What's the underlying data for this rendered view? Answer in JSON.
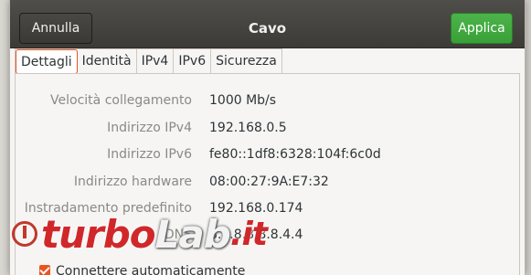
{
  "header": {
    "title": "Cavo",
    "cancel_label": "Annulla",
    "apply_label": "Applica"
  },
  "tabs": [
    {
      "label": "Dettagli",
      "active": true
    },
    {
      "label": "Identità",
      "active": false
    },
    {
      "label": "IPv4",
      "active": false
    },
    {
      "label": "IPv6",
      "active": false
    },
    {
      "label": "Sicurezza",
      "active": false
    }
  ],
  "details": [
    {
      "label": "Velocità collegamento",
      "value": "1000 Mb/s"
    },
    {
      "label": "Indirizzo IPv4",
      "value": "192.168.0.5"
    },
    {
      "label": "Indirizzo IPv6",
      "value": "fe80::1df8:6328:104f:6c0d"
    },
    {
      "label": "Indirizzo hardware",
      "value": "08:00:27:9A:E7:32"
    },
    {
      "label": "Instradamento predefinito",
      "value": "192.168.0.174"
    },
    {
      "label": "DNS",
      "value": "8.8.8.8 8.8.4.4"
    }
  ],
  "autoconnect": {
    "label": "Connettere automaticamente",
    "checked": true
  },
  "watermark": {
    "part1": "turbo",
    "part2": "Lab",
    "part3": ".it"
  },
  "colors": {
    "accent": "#e95420",
    "apply_button": "#3ea53c",
    "headerbar": "#45433f"
  }
}
